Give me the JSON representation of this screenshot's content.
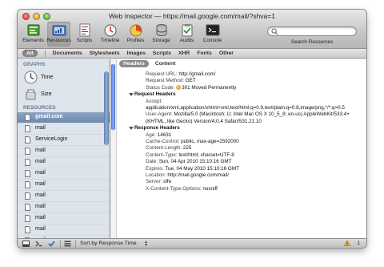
{
  "window": {
    "title": "Web Inspector — https://mail.google.com/mail/?shva=1"
  },
  "toolbar": {
    "tools": [
      {
        "label": "Elements",
        "icon": "elements-icon"
      },
      {
        "label": "Resources",
        "icon": "resources-icon",
        "active": true
      },
      {
        "label": "Scripts",
        "icon": "scripts-icon"
      },
      {
        "label": "Timeline",
        "icon": "timeline-icon"
      },
      {
        "label": "Profiles",
        "icon": "profiles-icon"
      },
      {
        "label": "Storage",
        "icon": "storage-icon"
      },
      {
        "label": "Audits",
        "icon": "audits-icon"
      },
      {
        "label": "Console",
        "icon": "console-icon"
      }
    ],
    "search_label": "Search Resources"
  },
  "filter_bar": {
    "items": [
      "All",
      "Documents",
      "Stylesheets",
      "Images",
      "Scripts",
      "XHR",
      "Fonts",
      "Other"
    ],
    "active": "All"
  },
  "sidebar": {
    "graphs_heading": "GRAPHS",
    "graphs": [
      {
        "label": "Time",
        "icon": "clock-icon"
      },
      {
        "label": "Size",
        "icon": "size-icon"
      }
    ],
    "resources_heading": "RESOURCES",
    "resources": [
      {
        "label": "gmail.com",
        "selected": true
      },
      {
        "label": "mail"
      },
      {
        "label": "ServiceLogin"
      },
      {
        "label": "mail"
      },
      {
        "label": "mail"
      },
      {
        "label": "mail"
      },
      {
        "label": "mail"
      },
      {
        "label": "mail"
      },
      {
        "label": "mail"
      },
      {
        "label": "mail"
      },
      {
        "label": "mail"
      },
      {
        "label": "mail"
      }
    ]
  },
  "detail": {
    "tabs": [
      "Headers",
      "Content"
    ],
    "active_tab": "Headers",
    "request_url_label": "Request URL:",
    "request_url": "http://gmail.com/",
    "request_method_label": "Request Method:",
    "request_method": "GET",
    "status_code_label": "Status Code:",
    "status_code": "301 Moved Permanently",
    "request_headers_title": "Request Headers",
    "request_headers": [
      {
        "key": "Accept:",
        "value": "application/xml,application/xhtml+xml,text/html;q=0.9,text/plain;q=0.8,image/png,*/*;q=0.5"
      },
      {
        "key": "User-Agent:",
        "value": "Mozilla/5.0 (Macintosh; U; Intel Mac OS X 10_5_8; en-us) AppleWebKit/533.4+ (KHTML, like Gecko) Version/4.0.4 Safari/531.21.10"
      }
    ],
    "response_headers_title": "Response Headers",
    "response_headers": [
      {
        "key": "Age:",
        "value": "14631"
      },
      {
        "key": "Cache-Control:",
        "value": "public, max-age=2592000"
      },
      {
        "key": "Content-Length:",
        "value": "225"
      },
      {
        "key": "Content-Type:",
        "value": "text/html; charset=UTF-8"
      },
      {
        "key": "Date:",
        "value": "Sun, 04 Apr 2010 15:10:16 GMT"
      },
      {
        "key": "Expires:",
        "value": "Tue, 04 May 2010 15:10:16 GMT"
      },
      {
        "key": "Location:",
        "value": "http://mail.google.com/mail/"
      },
      {
        "key": "Server:",
        "value": "sffe"
      },
      {
        "key": "X-Content-Type-Options:",
        "value": "nosniff"
      }
    ]
  },
  "bottom_bar": {
    "sort_label": "Sort by Response Time",
    "warning_count": "1"
  }
}
